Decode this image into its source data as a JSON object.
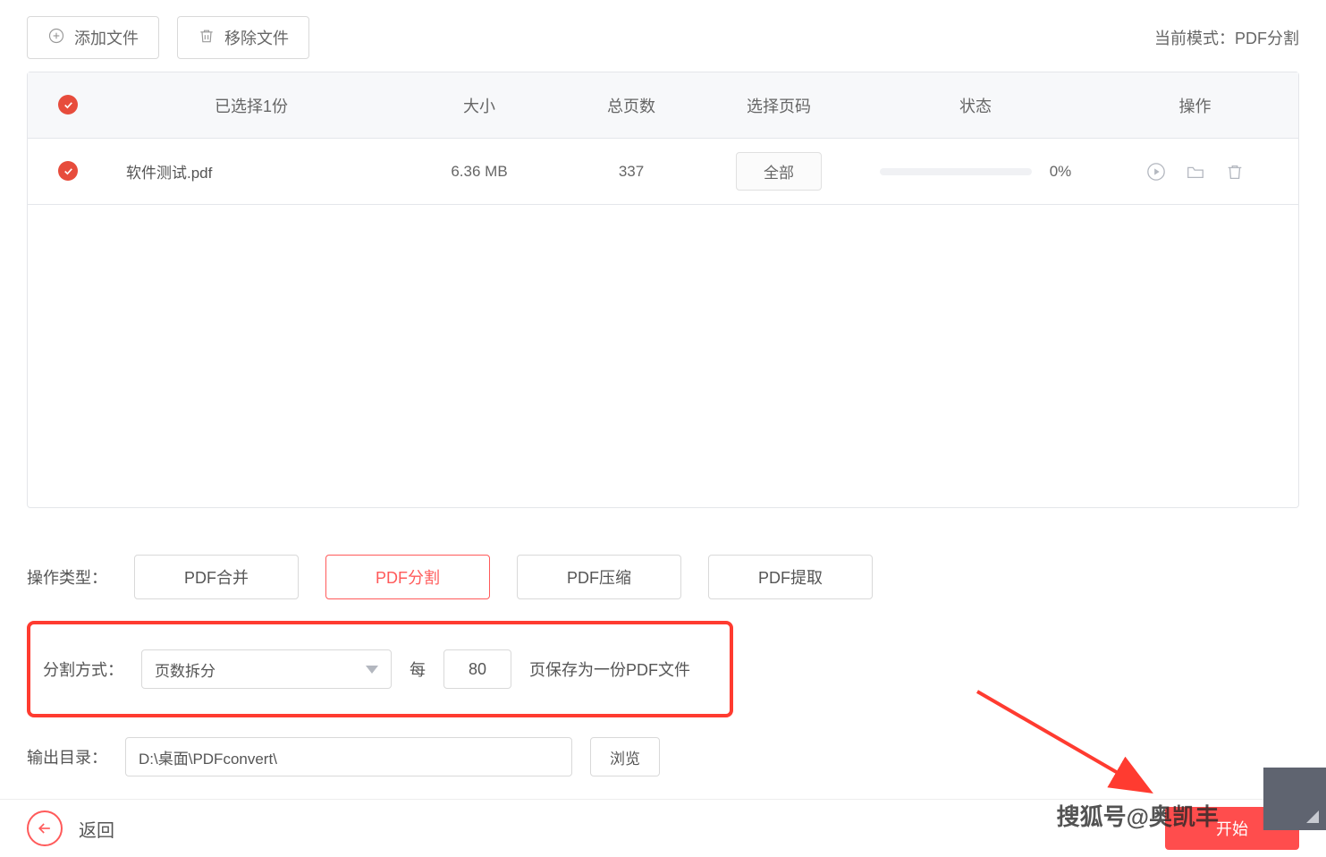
{
  "toolbar": {
    "add_file": "添加文件",
    "remove_file": "移除文件",
    "mode_label": "当前模式：",
    "mode_value": "PDF分割"
  },
  "table": {
    "headers": {
      "selected": "已选择1份",
      "size": "大小",
      "pages": "总页数",
      "select_pages": "选择页码",
      "status": "状态",
      "actions": "操作"
    },
    "rows": [
      {
        "filename": "软件测试.pdf",
        "size": "6.36 MB",
        "pages": "337",
        "page_select_label": "全部",
        "progress_pct": "0%"
      }
    ]
  },
  "op_type": {
    "label": "操作类型：",
    "tabs": {
      "merge": "PDF合并",
      "split": "PDF分割",
      "compress": "PDF压缩",
      "extract": "PDF提取"
    },
    "active": "split"
  },
  "split": {
    "label": "分割方式：",
    "method": "页数拆分",
    "prefix": "每",
    "value": "80",
    "suffix": "页保存为一份PDF文件"
  },
  "output": {
    "label": "输出目录：",
    "path": "D:\\桌面\\PDFconvert\\",
    "browse": "浏览"
  },
  "footer": {
    "back": "返回",
    "start": "开始"
  },
  "watermark": "搜狐号@奥凯丰"
}
